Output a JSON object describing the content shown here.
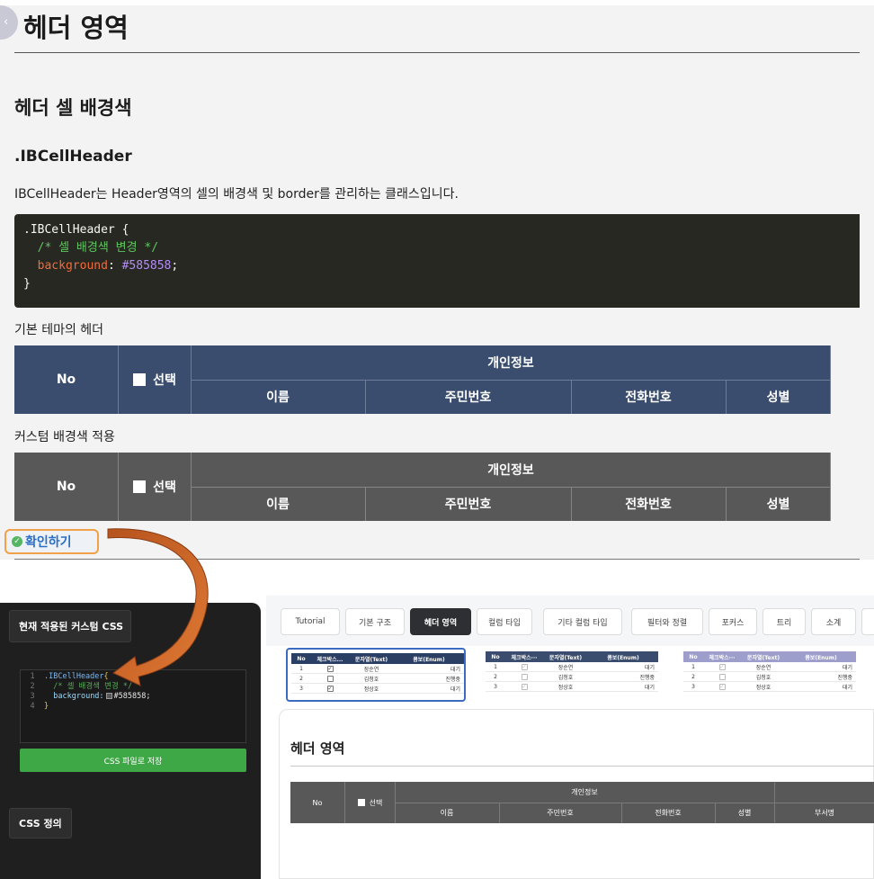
{
  "doc": {
    "title": "헤더 영역",
    "section_title": "헤더 셀 배경색",
    "class_name": ".IBCellHeader",
    "description": "IBCellHeader는 Header영역의 셀의 배경색 및 border를 관리하는 클래스입니다.",
    "code": {
      "line1": ".IBCellHeader {",
      "line2_comment": "/* 셀 배경색 변경 */",
      "line3_prop": "background",
      "line3_colon": ": ",
      "line3_value": "#585858",
      "line3_semicolon": ";",
      "line4": "}"
    },
    "label_default": "기본 테마의 헤더",
    "label_custom": "커스텀 배경색 적용",
    "table_header": {
      "no": "No",
      "select": "선택",
      "group": "개인정보",
      "name": "이름",
      "ssn": "주민번호",
      "phone": "전화번호",
      "gender": "성별"
    },
    "confirm_button": "확인하기",
    "back_icon": "chevron-left-icon",
    "default_header_color": "#3a4d6e",
    "custom_header_color": "#585858"
  },
  "panel": {
    "tab_current_css": "현재 적용된 커스텀 CSS",
    "tab_css_definition": "CSS 정의",
    "editor": {
      "ln1": "1",
      "ln2": "2",
      "ln3": "3",
      "ln4": "4",
      "line1": ".IBCellHeader",
      "line1_brace": "{",
      "line2": "/* 셀 배경색 변경 */",
      "line3_prop": "background:",
      "line3_value": "#585858;",
      "line4": "}"
    },
    "save_button": "CSS 파일로 저장"
  },
  "app": {
    "tabs": [
      "Tutorial",
      "기본 구조",
      "헤더 영역",
      "컬럼 타입",
      "기타 컬럼 타입",
      "필터와 정렬",
      "포커스",
      "트리",
      "소계"
    ],
    "active_tab": "헤더 영역",
    "preview_header": {
      "no": "No",
      "checkbox": "체크박스...",
      "checkbox_short": "체크박스···",
      "text": "문자열(Text)",
      "combo": "콤보(Enum)"
    },
    "preview_rows": [
      {
        "no": "1",
        "checked": true,
        "name": "장순연",
        "combo": "대기"
      },
      {
        "no": "2",
        "checked": false,
        "name": "김청호",
        "combo": "진행중"
      },
      {
        "no": "3",
        "checked": true,
        "name": "정상호",
        "combo": "대기"
      }
    ],
    "preview_rows_alt": [
      {
        "no": "1",
        "name": "장순연",
        "combo": "대기"
      },
      {
        "no": "2",
        "name": "김청호",
        "combo": "진행중"
      },
      {
        "no": "3",
        "name": "정상호",
        "combo": "대기"
      }
    ],
    "content_title": "헤더 영역",
    "grid_header": {
      "no": "No",
      "select": "선택",
      "group": "개인정보",
      "name": "이름",
      "ssn": "주민번호",
      "phone": "전화번호",
      "gender": "성별",
      "dept": "부서명"
    }
  }
}
